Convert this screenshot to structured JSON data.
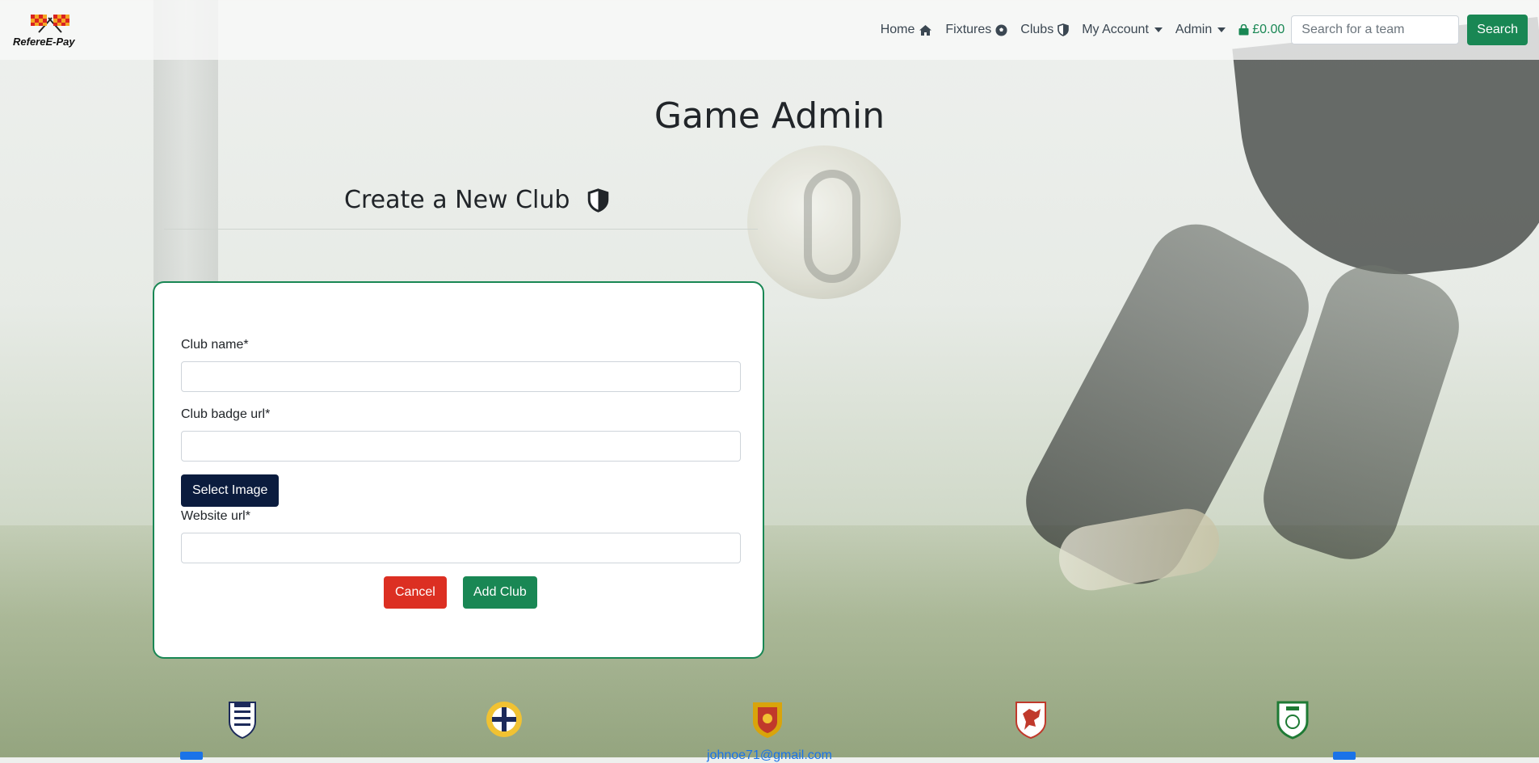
{
  "navbar": {
    "brand": "RefereE-Pay",
    "items": [
      {
        "label": "Home",
        "icon": "home-icon"
      },
      {
        "label": "Fixtures",
        "icon": "soccer-ball-icon"
      },
      {
        "label": "Clubs",
        "icon": "shield-icon"
      },
      {
        "label": "My Account",
        "icon": "caret-down-icon"
      },
      {
        "label": "Admin",
        "icon": "caret-down-icon"
      }
    ],
    "basket_total": "£0.00",
    "search_placeholder": "Search for a team",
    "search_button": "Search"
  },
  "page_title": "Game Admin",
  "section_title": "Create a New Club",
  "form": {
    "club_name_label": "Club name*",
    "club_badge_label": "Club badge url*",
    "select_image_button": "Select Image",
    "website_label": "Website url*",
    "cancel_button": "Cancel",
    "add_button": "Add Club"
  },
  "footer": {
    "badges": [
      "england-fa-badge",
      "northern-ireland-fa-badge",
      "scotland-fa-badge",
      "wales-fa-badge",
      "ireland-fai-badge"
    ],
    "email": "johnoe71@gmail.com"
  },
  "colors": {
    "primary_green": "#198754",
    "danger_red": "#dc2f22",
    "navy": "#0b1c3e",
    "link_blue": "#1a73e8"
  }
}
